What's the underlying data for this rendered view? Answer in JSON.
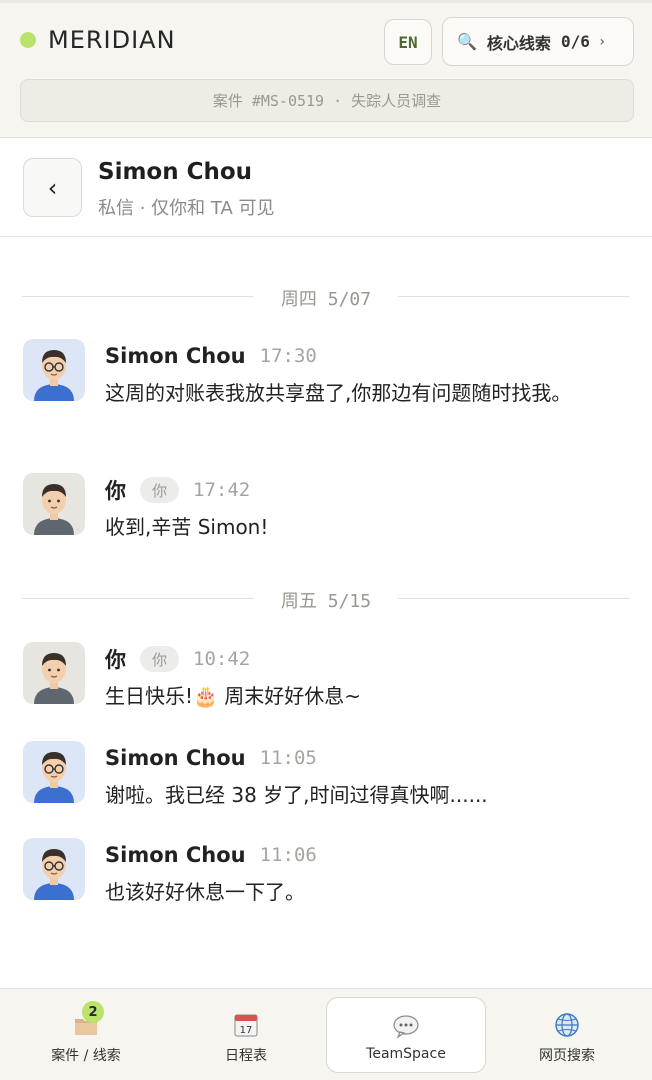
{
  "header": {
    "brand": "MERIDIAN",
    "lang_button": "EN",
    "clue_label": "核心线索",
    "clue_count": "0/6",
    "clue_chevron": "›",
    "case_info": "案件 #MS-0519 · 失踪人员调查",
    "accent_color": "#b9e36a"
  },
  "contact": {
    "back_symbol": "‹",
    "name": "Simon Chou",
    "subtitle": "私信 · 仅你和 TA 可见"
  },
  "dividers": [
    {
      "label": "周四 5/07"
    },
    {
      "label": "周五 5/15"
    }
  ],
  "messages": [
    {
      "sender": "Simon Chou",
      "self_tag": "",
      "time": "17:30",
      "text": "这周的对账表我放共享盘了,你那边有问题随时找我。",
      "avatar": "simon-avatar"
    },
    {
      "sender": "你",
      "self_tag": "你",
      "time": "17:42",
      "text": "收到,辛苦 Simon!",
      "avatar": "you-avatar"
    },
    {
      "sender": "你",
      "self_tag": "你",
      "time": "10:42",
      "text": "生日快乐!🎂 周末好好休息~",
      "avatar": "you-avatar"
    },
    {
      "sender": "Simon Chou",
      "self_tag": "",
      "time": "11:05",
      "text": "谢啦。我已经 38 岁了,时间过得真快啊......",
      "avatar": "simon-avatar"
    },
    {
      "sender": "Simon Chou",
      "self_tag": "",
      "time": "11:06",
      "text": "也该好好休息一下了。",
      "avatar": "simon-avatar"
    }
  ],
  "nav": {
    "items": [
      {
        "label": "案件 / 线索",
        "icon": "case-folder-icon",
        "badge": "2"
      },
      {
        "label": "日程表",
        "icon": "calendar-icon",
        "calendar_day": "17"
      },
      {
        "label": "TeamSpace",
        "icon": "chat-bubble-icon"
      },
      {
        "label": "网页搜索",
        "icon": "globe-icon"
      }
    ],
    "active": "TeamSpace"
  }
}
